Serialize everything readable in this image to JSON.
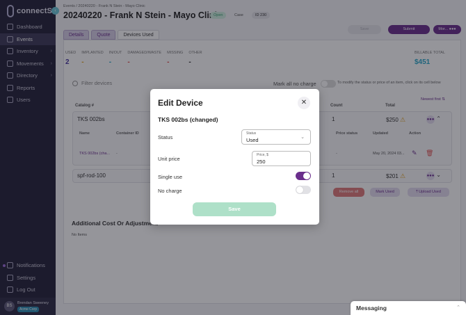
{
  "brand": {
    "name": "connectSX"
  },
  "sidebar": {
    "items": [
      {
        "label": "Dashboard",
        "icon": "dashboard-icon",
        "chevron": false
      },
      {
        "label": "Events",
        "icon": "events-icon",
        "chevron": false,
        "active": true
      },
      {
        "label": "Inventory",
        "icon": "inventory-icon",
        "chevron": true
      },
      {
        "label": "Movements",
        "icon": "movements-icon",
        "chevron": true
      },
      {
        "label": "Directory",
        "icon": "directory-icon",
        "chevron": true
      },
      {
        "label": "Reports",
        "icon": "reports-icon",
        "chevron": false
      },
      {
        "label": "Users",
        "icon": "users-icon",
        "chevron": false
      }
    ],
    "bottom_items": [
      {
        "label": "Notifications"
      },
      {
        "label": "Settings"
      },
      {
        "label": "Log Out"
      }
    ],
    "user": {
      "initials": "BS",
      "name": "Brendan Sweeney",
      "org": "Acme Corp"
    }
  },
  "header": {
    "breadcrumb": "Events / 20240220 - Frank N Stein - Mayo Clinic",
    "title": "20240220 - Frank N Stein - Mayo Clinic",
    "status_pill": "Open",
    "case_label": "Case",
    "id_pill": "ID 230",
    "save_label": "Save",
    "submit_label": "Submit",
    "more_label": "Mor..."
  },
  "tabs": [
    {
      "label": "Details"
    },
    {
      "label": "Quote"
    },
    {
      "label": "Devices Used",
      "active": true
    }
  ],
  "stats": [
    {
      "label": "USED",
      "value": "2"
    },
    {
      "label": "IMPLANTED",
      "value": "-"
    },
    {
      "label": "IN/OUT",
      "value": "-"
    },
    {
      "label": "DAMAGED/WASTE",
      "value": "-"
    },
    {
      "label": "MISSING",
      "value": "-"
    },
    {
      "label": "OTHER",
      "value": "-"
    }
  ],
  "billable": {
    "label": "BILLABLE TOTAL",
    "value": "$451"
  },
  "filter": {
    "placeholder": "Filter devices",
    "mark_all_label": "Mark all no charge",
    "hint": "To modify the status or price of an item, click on its cell below",
    "sort_label": "Newest first"
  },
  "table": {
    "headers": {
      "catalog": "Catalog #",
      "count": "Count",
      "total": "Total"
    },
    "sub_headers": {
      "name": "Name",
      "container": "Container ID",
      "price_status": "Price status",
      "updated": "Updated",
      "action": "Action"
    },
    "rows": [
      {
        "catalog": "TKS 002bs",
        "count": "1",
        "total": "$250",
        "item_name": "TKS 002bs (cha...",
        "container": "-",
        "price_status": "-",
        "updated": "May 20, 2024 03..."
      },
      {
        "catalog": "spf-rod-100",
        "count": "1",
        "total": "$201"
      }
    ],
    "remove_all": "Remove all",
    "mark_used": "Mark Used",
    "upload_used": "Upload Used"
  },
  "additional": {
    "title": "Additional Cost Or Adjustment",
    "empty": "No Items"
  },
  "messaging": {
    "label": "Messaging"
  },
  "modal": {
    "title": "Edit Device",
    "device_name": "TKS 002bs (changed)",
    "status_label": "Status",
    "status_field_label": "Status",
    "status_value": "Used",
    "unit_price_label": "Unit price",
    "price_field_label": "Price, $",
    "price_value": "250",
    "single_use_label": "Single use",
    "single_use": true,
    "no_charge_label": "No charge",
    "no_charge": false,
    "save_label": "Save"
  },
  "colors": {
    "sidebar_bg": "#24223a",
    "accent": "#6a2e8c",
    "billable": "#2aa7c8",
    "save_disabled": "#aee0c8",
    "open_pill": "#cfeee0"
  }
}
